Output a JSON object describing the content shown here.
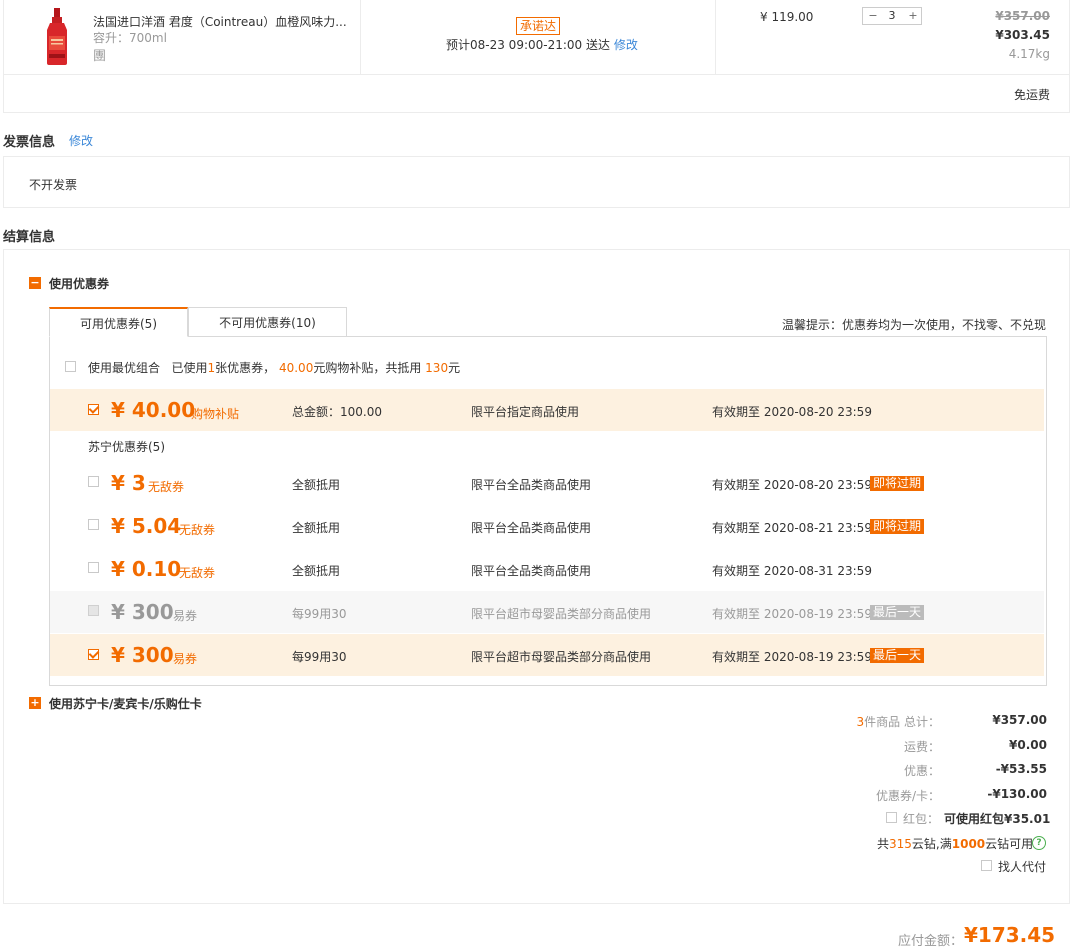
{
  "product": {
    "name": "法国进口洋酒 君度（Cointreau）血橙风味力...",
    "spec": "容升：700ml",
    "badge_char": "團",
    "promise_tag": "承诺达",
    "delivery": "预计08-23 09:00-21:00 送达",
    "delivery_edit": "修改",
    "unit_price": "¥ 119.00",
    "qty": "3",
    "minus": "−",
    "plus": "+",
    "orig_total": "¥357.00",
    "total": "¥303.45",
    "weight": "4.17kg",
    "shipping": "免运费"
  },
  "invoice": {
    "title": "发票信息",
    "edit": "修改",
    "value": "不开发票"
  },
  "settle": {
    "title": "结算信息"
  },
  "coupon": {
    "toggle_label": "使用优惠券",
    "toggle_icon": "−",
    "tab_available": "可用优惠券(5)",
    "tab_unavailable": "不可用优惠券(10)",
    "notice": "温馨提示：优惠券均为一次使用，不找零、不兑现",
    "best_combo_label": "使用最优组合",
    "best_combo_p1": "已使用",
    "best_combo_count": "1",
    "best_combo_p2": "张优惠券，",
    "best_combo_amount": "40.00",
    "best_combo_p3": "元购物补贴，共抵用",
    "best_combo_total": "130",
    "best_combo_p4": "元",
    "subsidy": {
      "amount": "¥ 40.00",
      "type": "购物补贴",
      "condition": "总金额：100.00",
      "scope": "限平台指定商品使用",
      "expiry": "有效期至 2020-08-20 23:59"
    },
    "suning_group": "苏宁优惠券(5)",
    "items": [
      {
        "amount": "¥ 3",
        "type": "无敌券",
        "condition": "全额抵用",
        "scope": "限平台全品类商品使用",
        "expiry": "有效期至 2020-08-20 23:59",
        "badge": "即将过期"
      },
      {
        "amount": "¥ 5.04",
        "type": "无敌券",
        "condition": "全额抵用",
        "scope": "限平台全品类商品使用",
        "expiry": "有效期至 2020-08-21 23:59",
        "badge": "即将过期"
      },
      {
        "amount": "¥ 0.10",
        "type": "无敌券",
        "condition": "全额抵用",
        "scope": "限平台全品类商品使用",
        "expiry": "有效期至 2020-08-31 23:59",
        "badge": ""
      },
      {
        "amount": "¥ 300",
        "type": "易券",
        "condition": "每99用30",
        "scope": "限平台超市母婴品类部分商品使用",
        "expiry": "有效期至 2020-08-19 23:59",
        "badge": "最后一天"
      },
      {
        "amount": "¥ 300",
        "type": "易券",
        "condition": "每99用30",
        "scope": "限平台超市母婴品类部分商品使用",
        "expiry": "有效期至 2020-08-19 23:59",
        "badge": "最后一天"
      }
    ]
  },
  "card": {
    "toggle_icon": "+",
    "label": "使用苏宁卡/麦宾卡/乐购仕卡"
  },
  "summary": {
    "count": "3",
    "count_label": "件商品 总计：",
    "total": "¥357.00",
    "shipping_label": "运费：",
    "shipping": "¥0.00",
    "discount_label": "优惠：",
    "discount": "-¥53.55",
    "coupon_label": "优惠券/卡：",
    "coupon": "-¥130.00",
    "redpack_label": "红包：",
    "redpack_value": "可使用红包¥35.01",
    "diamond_p1": "共",
    "diamond_count": "315",
    "diamond_p2": "云钻,满",
    "diamond_min": "1000",
    "diamond_p3": "云钻可用",
    "help_icon": "?",
    "proxy_pay": "找人代付",
    "payable_label": "应付金额：",
    "payable": "¥173.45"
  }
}
